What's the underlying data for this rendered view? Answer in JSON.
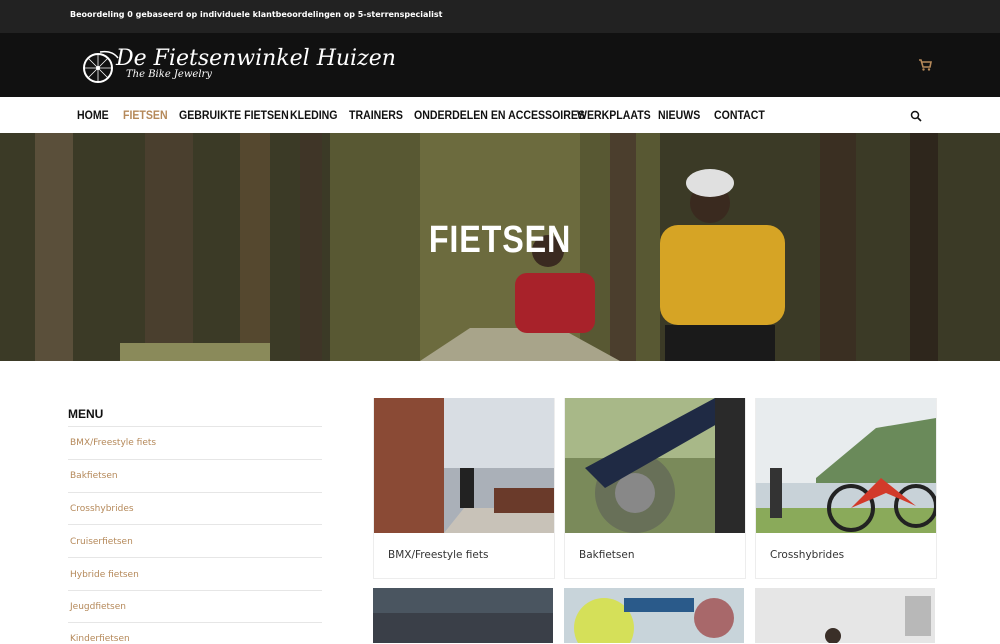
{
  "topbar": {
    "rating_text": "Beoordeling 0 gebaseerd op  individuele klantbeoordelingen op 5-sterrenspecialist"
  },
  "brand": {
    "title": "De Fietsenwinkel Huizen",
    "subtitle": "The Bike Jewelry"
  },
  "nav": {
    "items": [
      {
        "label": "HOME"
      },
      {
        "label": "FIETSEN",
        "active": true
      },
      {
        "label": "GEBRUIKTE FIETSEN"
      },
      {
        "label": "KLEDING"
      },
      {
        "label": "TRAINERS"
      },
      {
        "label": "ONDERDELEN EN ACCESSOIRES"
      },
      {
        "label": "WERKPLAATS"
      },
      {
        "label": "NIEUWS"
      },
      {
        "label": "CONTACT"
      }
    ]
  },
  "hero": {
    "title": "FIETSEN"
  },
  "sidebar": {
    "title": "MENU",
    "items": [
      {
        "label": "BMX/Freestyle fiets"
      },
      {
        "label": "Bakfietsen"
      },
      {
        "label": "Crosshybrides"
      },
      {
        "label": "Cruiserfietsen"
      },
      {
        "label": "Hybride fietsen"
      },
      {
        "label": "Jeugdfietsen"
      },
      {
        "label": "Kinderfietsen"
      }
    ]
  },
  "products": [
    {
      "label": "BMX/Freestyle fiets"
    },
    {
      "label": "Bakfietsen"
    },
    {
      "label": "Crosshybrides"
    },
    {
      "label": ""
    },
    {
      "label": ""
    },
    {
      "label": ""
    }
  ],
  "colors": {
    "accent": "#b5895a",
    "topbar": "#222222",
    "header": "#111111"
  }
}
